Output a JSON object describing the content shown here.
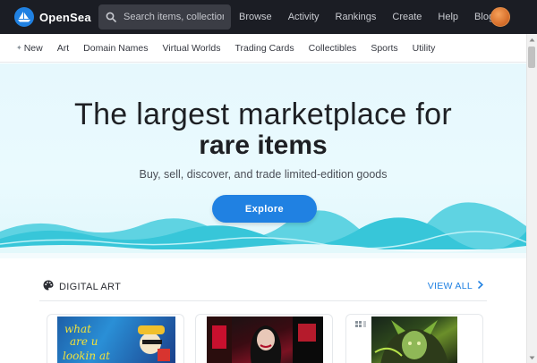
{
  "header": {
    "logo_text": "OpenSea",
    "search": {
      "placeholder": "Search items, collections, a"
    },
    "nav": [
      "Browse",
      "Activity",
      "Rankings",
      "Create",
      "Help",
      "Blog"
    ]
  },
  "categories": [
    "New",
    "Art",
    "Domain Names",
    "Virtual Worlds",
    "Trading Cards",
    "Collectibles",
    "Sports",
    "Utility"
  ],
  "hero": {
    "title_line1": "The largest marketplace for",
    "title_line2": "rare items",
    "subtitle": "Buy, sell, discover, and trade limited-edition goods",
    "cta_label": "Explore"
  },
  "section": {
    "title": "DIGITAL ART",
    "view_all": "VIEW ALL"
  },
  "colors": {
    "accent": "#2081e2",
    "topbar": "#1b1d24",
    "hero_bg": "#e6f8fd",
    "wave": "#37c6d9"
  },
  "icons": {
    "logo": "opensea-boat-icon",
    "search": "search-icon",
    "new": "sparkle-icon",
    "section": "palette-icon",
    "view_all": "chevron-right-icon"
  }
}
